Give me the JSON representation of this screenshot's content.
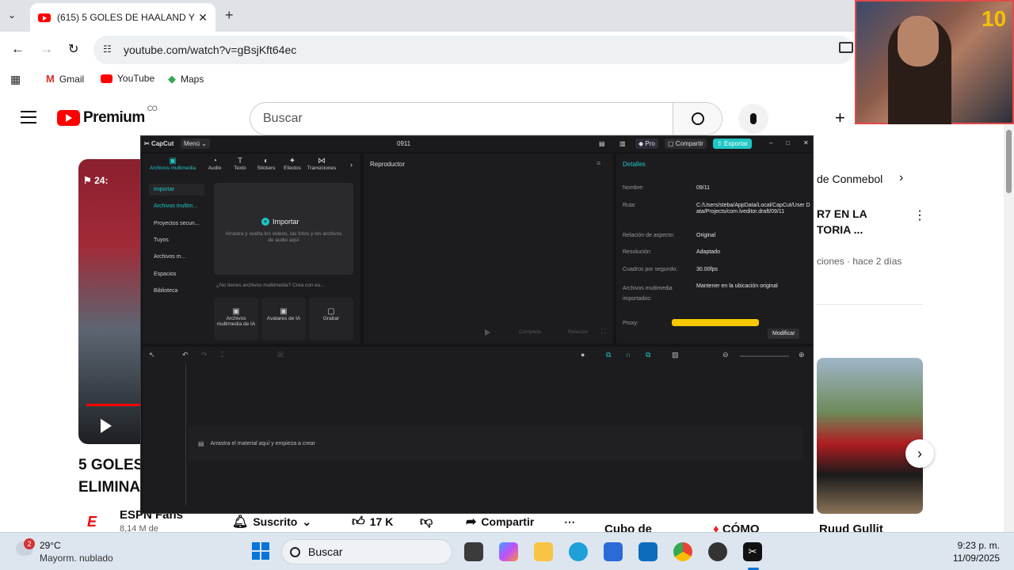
{
  "browser": {
    "tab_title": "(615) 5 GOLES DE HAALAND Y",
    "url": "youtube.com/watch?v=gBsjKft64ec",
    "bookmarks": [
      "Gmail",
      "YouTube",
      "Maps"
    ]
  },
  "youtube": {
    "logo_text": "Premium",
    "country": "CO",
    "search_placeholder": "Buscar",
    "video_title_line1": "5 GOLES",
    "video_title_line2": "ELIMINA",
    "channel_name": "ESPN Fans",
    "subscribers": "8,14 M de",
    "subscribed_label": "Suscrito",
    "likes": "17 K",
    "share_label": "Compartir",
    "thumb_time": "24:",
    "related": {
      "chip": "de Conmebol",
      "item1_line1": "R7 EN LA",
      "item1_line2": "TORIA ...",
      "item1_meta": "ciones · hace 2 días",
      "item2_title": "Ruud Gullit",
      "item3_title": "Cubo de",
      "item4_title": "CÓMO"
    }
  },
  "capcut": {
    "app_name": "CapCut",
    "menu_label": "Menú",
    "project_title": "0911",
    "pro_label": "Pro",
    "share_label": "Compartir",
    "export_label": "Exportar",
    "tools": [
      "Archivos multimedia",
      "Audio",
      "Texto",
      "Stickers",
      "Efectos",
      "Transiciones"
    ],
    "sidebar": [
      "Importar",
      "Archivos multim...",
      "Proyectos secun...",
      "Tuyos",
      "Archivos m...",
      "Espacios",
      "Biblioteca"
    ],
    "import_button": "Importar",
    "import_hint": "Arrastra y suelta los videos, las fotos y los archivos de audio aquí",
    "no_media_hint": "¿No tienes archivos multimedia? Crea con es...",
    "create_cards": [
      "Archivos multimedia de IA",
      "Avatares de IA",
      "Grabar"
    ],
    "player_title": "Reproductor",
    "player_footer": [
      "Completa",
      "Relación"
    ],
    "details_title": "Detalles",
    "details": [
      {
        "label": "Nombre:",
        "value": "09/11"
      },
      {
        "label": "Ruta:",
        "value": "C:/Users/steba/AppData/Local/CapCut/User Data/Projects/com.lveditor.draft/09/11"
      },
      {
        "label": "Relación de aspecto:",
        "value": "Original"
      },
      {
        "label": "Resolución:",
        "value": "Adaptado"
      },
      {
        "label": "Cuadros por segundo:",
        "value": "30.00fps"
      },
      {
        "label": "Archivos multimedia importados:",
        "value": "Mantener en la ubicación original"
      }
    ],
    "proxy_label": "Proxy:",
    "modify_button": "Modificar",
    "timeline_hint": "Arrastra el material aquí y empieza a crear"
  },
  "taskbar": {
    "weather_temp": "29°C",
    "weather_desc": "Mayorm. nublado",
    "weather_badge": "2",
    "search_label": "Buscar",
    "time": "9:23 p. m.",
    "date": "11/09/2025"
  }
}
